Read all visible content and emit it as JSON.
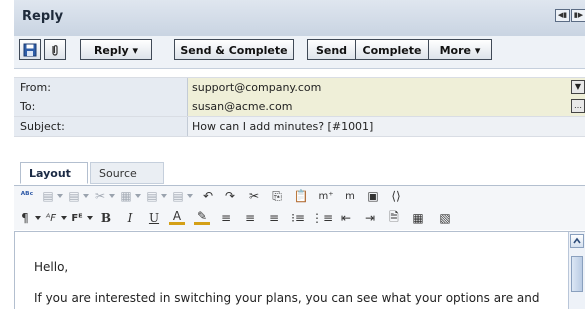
{
  "window": {
    "title": "Reply"
  },
  "toolbar": {
    "reply_label": "Reply",
    "send_complete_label": "Send & Complete",
    "send_label": "Send",
    "complete_label": "Complete",
    "more_label": "More"
  },
  "fields": {
    "from": {
      "label": "From:",
      "value": "support@company.com"
    },
    "to": {
      "label": "To:",
      "value": "susan@acme.com"
    },
    "subject": {
      "label": "Subject:",
      "value": "How can I add minutes? [#1001]"
    }
  },
  "tabs": {
    "layout": "Layout",
    "source": "Source"
  },
  "editor": {
    "greeting": "Hello,",
    "body_line1": "If you are interested in switching your plans, you can see what your options are and"
  },
  "colors": {
    "titlebar": "#c9d4e2",
    "field_value_bg": "#efefd8",
    "field_label_bg": "#e6ebf2"
  }
}
